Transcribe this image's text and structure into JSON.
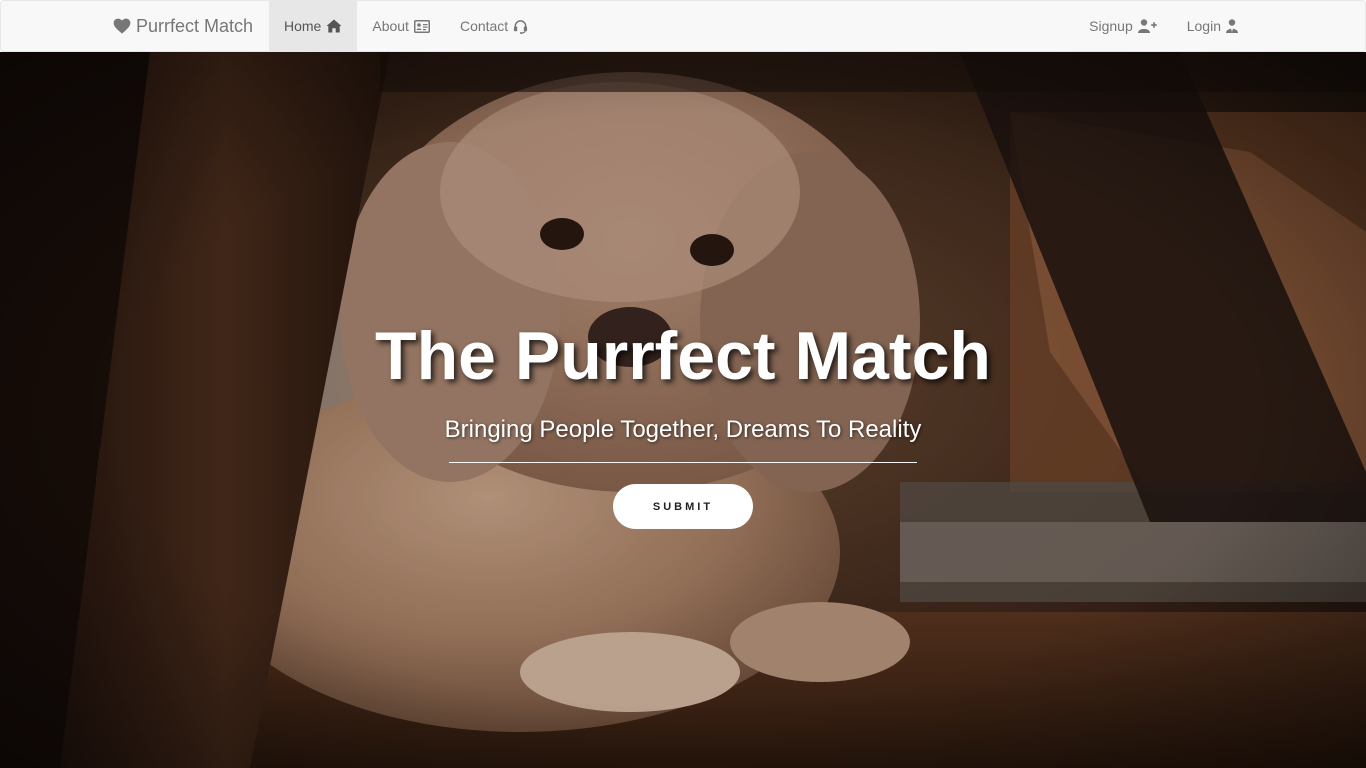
{
  "brand": {
    "label": "Purrfect Match",
    "icon": "heart-icon"
  },
  "nav": {
    "home": {
      "label": "Home",
      "icon": "home-icon"
    },
    "about": {
      "label": "About",
      "icon": "id-card-icon"
    },
    "contact": {
      "label": "Contact",
      "icon": "headset-icon"
    },
    "signup": {
      "label": "Signup",
      "icon": "user-plus-icon"
    },
    "login": {
      "label": "Login",
      "icon": "user-icon"
    }
  },
  "hero": {
    "title": "The Purrfect Match",
    "subtitle": "Bringing People Together, Dreams To Reality",
    "button_label": "SUBMIT",
    "background": "photo of a small fluffy dog lying on a wooden floor"
  },
  "colors": {
    "navbar_bg": "#f8f8f8",
    "nav_text": "#777777",
    "nav_active_bg": "#e7e7e7",
    "hero_text": "#ffffff",
    "button_bg": "#ffffff"
  }
}
